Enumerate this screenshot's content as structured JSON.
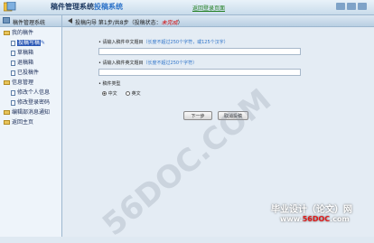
{
  "header": {
    "title_main": "稿件管理系统",
    "title_sub": "投稿系统",
    "link": "返回登录页面"
  },
  "sidebar": {
    "header": "稿件管理系统",
    "items": [
      {
        "label": "我的稿件",
        "type": "folder",
        "level": 1
      },
      {
        "label": "投稿写稿",
        "type": "doc",
        "level": 2,
        "selected": true
      },
      {
        "label": "草稿箱",
        "type": "doc",
        "level": 2
      },
      {
        "label": "退稿箱",
        "type": "doc",
        "level": 2
      },
      {
        "label": "已投稿件",
        "type": "doc",
        "level": 2
      },
      {
        "label": "信息管理",
        "type": "folder",
        "level": 1
      },
      {
        "label": "修改个人信息",
        "type": "doc",
        "level": 2
      },
      {
        "label": "修改登录密码",
        "type": "doc",
        "level": 2
      },
      {
        "label": "编辑部消息通知",
        "type": "folder",
        "level": 1
      },
      {
        "label": "返回主页",
        "type": "folder",
        "level": 1
      }
    ]
  },
  "topbar": {
    "text": "投稿向导    第1步/共8步（投稿状态：",
    "status": "未完成",
    "end": "）"
  },
  "form": {
    "cn_title_label": "• 请输入稿件中文题目",
    "cn_title_hint": "（长度不超过250个字符，或125个汉字）",
    "cn_title_value": "",
    "en_title_label": "• 请输入稿件英文题目",
    "en_title_hint": "（长度不超过250个字符）",
    "en_title_value": "",
    "type_label": "• 稿件类型",
    "type_options": [
      "中文",
      "英文"
    ],
    "type_selected": "中文",
    "next_button": "下一步",
    "cancel_button": "取消投稿"
  },
  "watermark": {
    "center": "56DOC.COM",
    "corner_title": "毕业设计（论文）网",
    "corner_url_prefix": "www.",
    "corner_url_red": "56DOC",
    "corner_url_suffix": ".com"
  }
}
